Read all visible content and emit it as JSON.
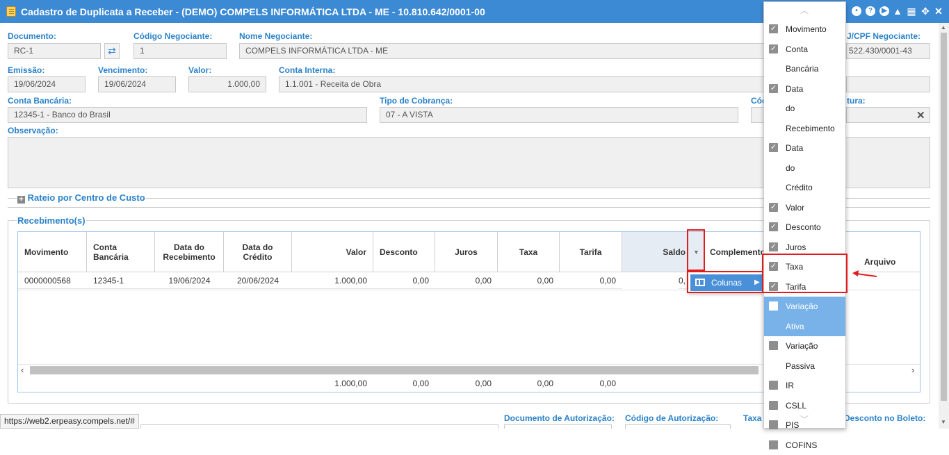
{
  "window": {
    "title": "Cadastro de Duplicata a Receber - (DEMO) COMPELS INFORMÁTICA LTDA - ME - 10.810.642/0001-00"
  },
  "form": {
    "documento_label": "Documento:",
    "documento_value": "RC-1",
    "cod_negociante_label": "Código Negociante:",
    "cod_negociante_value": "1",
    "nome_negociante_label": "Nome Negociante:",
    "nome_negociante_value": "COMPELS INFORMÁTICA LTDA - ME",
    "cnpj_label": "J/CPF Negociante:",
    "cnpj_value": "522.430/0001-43",
    "emissao_label": "Emissão:",
    "emissao_value": "19/06/2024",
    "vencimento_label": "Vencimento:",
    "vencimento_value": "19/06/2024",
    "valor_label": "Valor:",
    "valor_value": "1.000,00",
    "conta_interna_label": "Conta Interna:",
    "conta_interna_value": "1.1.001 - Receita de Obra",
    "conta_bancaria_label": "Conta Bancária:",
    "conta_bancaria_value": "12345-1 - Banco do Brasil",
    "tipo_cobranca_label": "Tipo de Cobrança:",
    "tipo_cobranca_value": "07 - A VISTA",
    "cod_label": "Cód",
    "fatura_label": "tura:",
    "observacao_label": "Observação:",
    "rateio_label": "Rateio por Centro de Custo",
    "recebimentos_label": "Recebimento(s)",
    "doc_autorizacao_label": "Documento de Autorização:",
    "cod_autorizacao_label": "Código de Autorização:",
    "taxa_label": "Taxa",
    "desconto_boleto_label": "Desconto no Boleto:"
  },
  "grid": {
    "headers": [
      "Movimento",
      "Conta Bancária",
      "Data do Recebimento",
      "Data do Crédito",
      "Valor",
      "Desconto",
      "Juros",
      "Taxa",
      "Tarifa",
      "Saldo",
      "Complemento",
      "Arquivo"
    ],
    "row": [
      "0000000568",
      "12345-1",
      "19/06/2024",
      "20/06/2024",
      "1.000,00",
      "0,00",
      "0,00",
      "0,00",
      "0,00",
      "0,"
    ],
    "footer": [
      "1.000,00",
      "0,00",
      "0,00",
      "0,00",
      "0,00"
    ]
  },
  "column_menu": {
    "label": "Colunas"
  },
  "columns_list": [
    {
      "label": "Movimento",
      "checked": true
    },
    {
      "label": "Conta Bancária",
      "checked": true
    },
    {
      "label": "Data do Recebimento",
      "checked": true
    },
    {
      "label": "Data do Crédito",
      "checked": true
    },
    {
      "label": "Valor",
      "checked": true
    },
    {
      "label": "Desconto",
      "checked": true
    },
    {
      "label": "Juros",
      "checked": true
    },
    {
      "label": "Taxa",
      "checked": true
    },
    {
      "label": "Tarifa",
      "checked": true
    },
    {
      "label": "Variação Ativa",
      "checked": false
    },
    {
      "label": "Variação Passiva",
      "checked": false
    },
    {
      "label": "IR",
      "checked": false
    },
    {
      "label": "CSLL",
      "checked": false
    },
    {
      "label": "PIS",
      "checked": false
    },
    {
      "label": "COFINS",
      "checked": false
    }
  ],
  "status_url": "https://web2.erpeasy.compels.net/#",
  "colors": {
    "titlebar": "#3d8ad4",
    "label": "#2a82c9",
    "highlight": "#79b2e8",
    "annotation": "#e11c1c"
  },
  "icons": [
    "refresh-icon",
    "close-icon",
    "plus-icon",
    "columns-icon",
    "sort-down-icon",
    "check-icon",
    "arrow-icon"
  ]
}
